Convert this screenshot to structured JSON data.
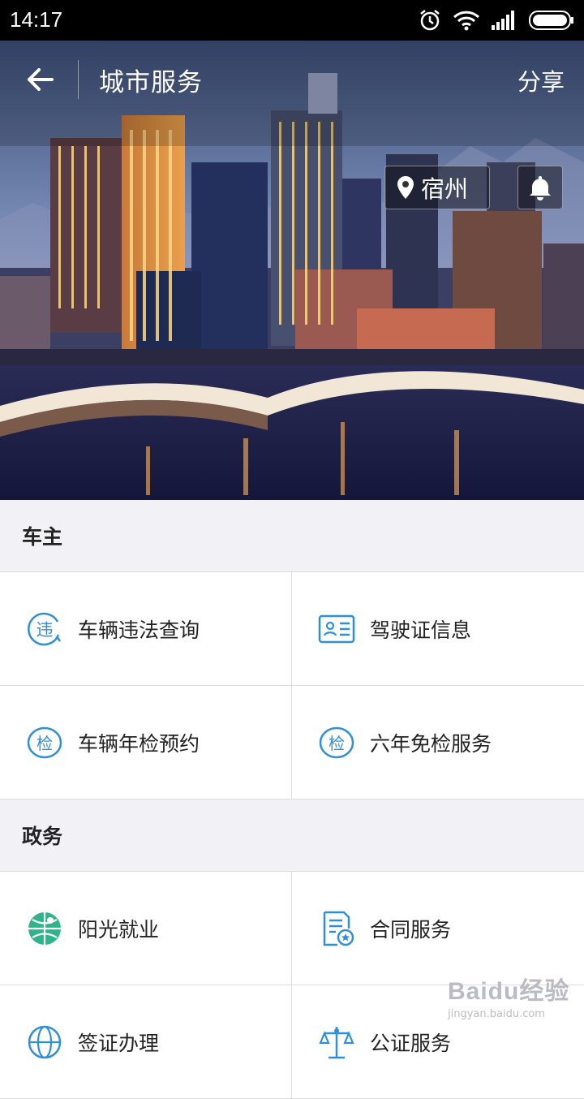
{
  "status_bar": {
    "time": "14:17"
  },
  "header": {
    "title": "城市服务",
    "share_label": "分享"
  },
  "location": {
    "city": "宿州"
  },
  "sections": [
    {
      "title": "车主",
      "items": [
        {
          "label": "车辆违法查询",
          "icon": "violation-icon"
        },
        {
          "label": "驾驶证信息",
          "icon": "license-icon"
        },
        {
          "label": "车辆年检预约",
          "icon": "inspection-icon"
        },
        {
          "label": "六年免检服务",
          "icon": "inspection-icon"
        }
      ]
    },
    {
      "title": "政务",
      "items": [
        {
          "label": "阳光就业",
          "icon": "globe-icon"
        },
        {
          "label": "合同服务",
          "icon": "contract-icon"
        },
        {
          "label": "签证办理",
          "icon": "visa-icon"
        },
        {
          "label": "公证服务",
          "icon": "notary-icon"
        }
      ]
    }
  ],
  "watermark": {
    "brand": "Baidu经验",
    "url": "jingyan.baidu.com"
  },
  "colors": {
    "accent": "#2f8fd8",
    "background": "#f2f2f6",
    "green": "#2fb38a"
  }
}
